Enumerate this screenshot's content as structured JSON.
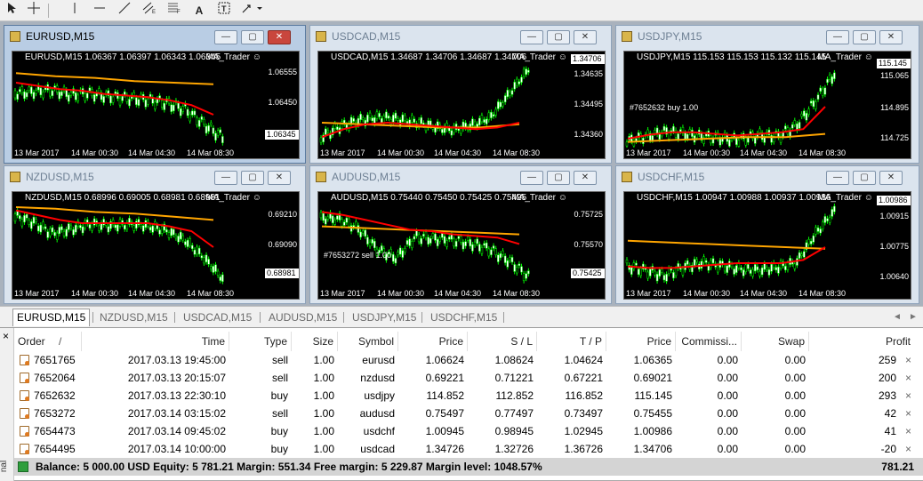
{
  "toolbar": {
    "icons": [
      "cursor-icon",
      "crosshair-icon",
      "vertical-line-icon",
      "horizontal-line-icon",
      "trendline-icon",
      "equidistant-channel-icon",
      "fibonacci-icon",
      "text-icon",
      "text-label-icon",
      "arrows-dropdown-icon"
    ],
    "text_label": "A"
  },
  "windows": [
    {
      "title": "EURUSD,M15",
      "symbol_line": "EURUSD,M15  1.06367 1.06397 1.06343 1.06345",
      "ea": "MA_Trader ☺",
      "prices": [
        "1.06555",
        "1.06450",
        "1.06345"
      ],
      "current": "1.06345",
      "xlabels": [
        "13 Mar 2017",
        "14 Mar 00:30",
        "14 Mar 04:30",
        "14 Mar 08:30"
      ],
      "order_label": "",
      "colors": {
        "fast": "#ff0000",
        "slow": "#ffa500",
        "candle": "#00ff00"
      }
    },
    {
      "title": "USDCAD,M15",
      "symbol_line": "USDCAD,M15  1.34687 1.34706 1.34687 1.34706",
      "ea": "MA_Trader ☺",
      "prices": [
        "1.34706",
        "1.34635",
        "1.34495",
        "1.34360"
      ],
      "current": "1.34706",
      "xlabels": [
        "13 Mar 2017",
        "14 Mar 00:30",
        "14 Mar 04:30",
        "14 Mar 08:30"
      ],
      "order_label": ""
    },
    {
      "title": "USDJPY,M15",
      "symbol_line": "USDJPY,M15  115.153 115.153 115.132 115.145",
      "ea": "MA_Trader ☺",
      "prices": [
        "115.145",
        "115.065",
        "114.895",
        "114.725"
      ],
      "current": "115.145",
      "xlabels": [
        "13 Mar 2017",
        "14 Mar 00:30",
        "14 Mar 04:30",
        "14 Mar 08:30"
      ],
      "order_label": "#7652632 buy 1.00"
    },
    {
      "title": "NZDUSD,M15",
      "symbol_line": "NZDUSD,M15  0.68996 0.69005 0.68981 0.68981",
      "ea": "MA_Trader ☺",
      "prices": [
        "0.69210",
        "0.69090",
        "0.68981"
      ],
      "current": "0.68981",
      "xlabels": [
        "13 Mar 2017",
        "14 Mar 00:30",
        "14 Mar 04:30",
        "14 Mar 08:30"
      ],
      "order_label": ""
    },
    {
      "title": "AUDUSD,M15",
      "symbol_line": "AUDUSD,M15  0.75440 0.75450 0.75425 0.75425",
      "ea": "MA_Trader ☺",
      "prices": [
        "0.75725",
        "0.75570",
        "0.75425"
      ],
      "current": "0.75425",
      "xlabels": [
        "13 Mar 2017",
        "14 Mar 00:30",
        "14 Mar 04:30",
        "14 Mar 08:30"
      ],
      "order_label": "#7653272 sell 1.00"
    },
    {
      "title": "USDCHF,M15",
      "symbol_line": "USDCHF,M15  1.00947 1.00988 1.00937 1.00986",
      "ea": "MA_Trader ☺",
      "prices": [
        "1.00986",
        "1.00915",
        "1.00775",
        "1.00640"
      ],
      "current": "1.00986",
      "xlabels": [
        "13 Mar 2017",
        "14 Mar 00:30",
        "14 Mar 04:30",
        "14 Mar 08:30"
      ],
      "order_label": ""
    }
  ],
  "chart_tabs": [
    "EURUSD,M15",
    "NZDUSD,M15",
    "USDCAD,M15",
    "AUDUSD,M15",
    "USDJPY,M15",
    "USDCHF,M15"
  ],
  "terminal": {
    "columns": [
      "Order",
      "/",
      "Time",
      "Type",
      "Size",
      "Symbol",
      "Price",
      "S / L",
      "T / P",
      "Price",
      "Commissi...",
      "Swap",
      "Profit"
    ],
    "rows": [
      {
        "order": "7651765",
        "time": "2017.03.13 19:45:00",
        "type": "sell",
        "size": "1.00",
        "symbol": "eurusd",
        "price": "1.06624",
        "sl": "1.08624",
        "tp": "1.04624",
        "cur_price": "1.06365",
        "commission": "0.00",
        "swap": "0.00",
        "profit": "259"
      },
      {
        "order": "7652064",
        "time": "2017.03.13 20:15:07",
        "type": "sell",
        "size": "1.00",
        "symbol": "nzdusd",
        "price": "0.69221",
        "sl": "0.71221",
        "tp": "0.67221",
        "cur_price": "0.69021",
        "commission": "0.00",
        "swap": "0.00",
        "profit": "200"
      },
      {
        "order": "7652632",
        "time": "2017.03.13 22:30:10",
        "type": "buy",
        "size": "1.00",
        "symbol": "usdjpy",
        "price": "114.852",
        "sl": "112.852",
        "tp": "116.852",
        "cur_price": "115.145",
        "commission": "0.00",
        "swap": "0.00",
        "profit": "293"
      },
      {
        "order": "7653272",
        "time": "2017.03.14 03:15:02",
        "type": "sell",
        "size": "1.00",
        "symbol": "audusd",
        "price": "0.75497",
        "sl": "0.77497",
        "tp": "0.73497",
        "cur_price": "0.75455",
        "commission": "0.00",
        "swap": "0.00",
        "profit": "42"
      },
      {
        "order": "7654473",
        "time": "2017.03.14 09:45:02",
        "type": "buy",
        "size": "1.00",
        "symbol": "usdchf",
        "price": "1.00945",
        "sl": "0.98945",
        "tp": "1.02945",
        "cur_price": "1.00986",
        "commission": "0.00",
        "swap": "0.00",
        "profit": "41"
      },
      {
        "order": "7654495",
        "time": "2017.03.14 10:00:00",
        "type": "buy",
        "size": "1.00",
        "symbol": "usdcad",
        "price": "1.34726",
        "sl": "1.32726",
        "tp": "1.36726",
        "cur_price": "1.34706",
        "commission": "0.00",
        "swap": "0.00",
        "profit": "-20"
      }
    ],
    "balance_line": "Balance: 5 000.00 USD  Equity: 5 781.21  Margin: 551.34  Free margin: 5 229.87  Margin level: 1048.57%",
    "total_profit": "781.21",
    "side_label": "nal",
    "close_glyph": "×",
    "side_close": "×"
  }
}
